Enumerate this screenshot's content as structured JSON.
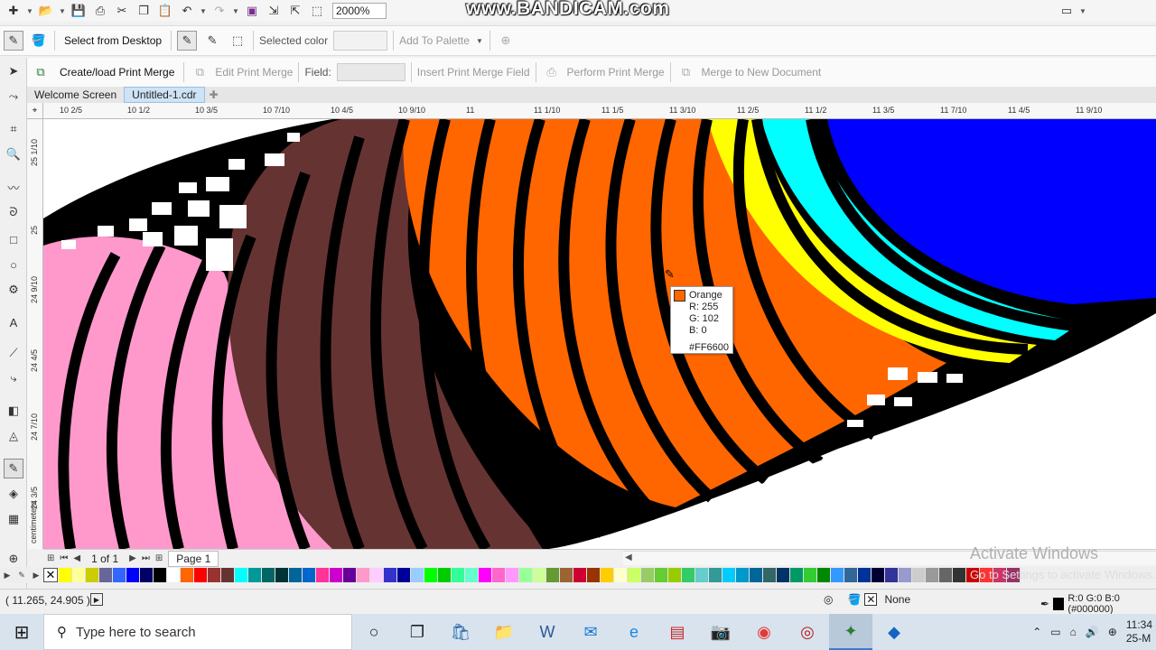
{
  "watermark": "www.BANDICAM.com",
  "toolbar": {
    "zoom_value": "2000%"
  },
  "propbar": {
    "select_from_desktop": "Select from Desktop",
    "selected_color_label": "Selected color",
    "add_to_palette": "Add To Palette"
  },
  "mergebar": {
    "create_load": "Create/load Print Merge",
    "edit": "Edit Print Merge",
    "field_label": "Field:",
    "insert_field": "Insert Print Merge Field",
    "perform": "Perform Print Merge",
    "merge_new_doc": "Merge to New Document"
  },
  "tabs": [
    {
      "label": "Welcome Screen"
    },
    {
      "label": "Untitled-1.cdr"
    }
  ],
  "hruler_ticks": [
    "10 2/5",
    "10 1/2",
    "10 3/5",
    "10 7/10",
    "10 4/5",
    "10 9/10",
    "11",
    "11 1/10",
    "11 1/5",
    "11 3/10",
    "11 2/5",
    "11 1/2",
    "11 3/5",
    "11 7/10",
    "11 4/5",
    "11 9/10"
  ],
  "vruler_ticks": [
    "25 1/10",
    "25",
    "24 9/10",
    "24 4/5",
    "24 7/10",
    "24 3/5"
  ],
  "vruler_unit": "centimeters",
  "tooltip": {
    "name": "Orange",
    "r": "R: 255",
    "g": "G: 102",
    "b": "B: 0",
    "hex": "#FF6600"
  },
  "colors": {
    "orange": "#ff6600",
    "brown": "#663333",
    "pink": "#ff99cc",
    "yellow": "#ffff00",
    "cyan": "#00ffff",
    "blue": "#0000ff"
  },
  "pagebar": {
    "page_count": "1 of 1",
    "page_tab": "Page 1"
  },
  "palette": [
    "#ffff00",
    "#ffff99",
    "#cccc00",
    "#666699",
    "#3366ff",
    "#0000ff",
    "#000066",
    "#000000",
    "#ffffff",
    "#ff6600",
    "#ff0000",
    "#993333",
    "#663333",
    "#00ffff",
    "#009999",
    "#006666",
    "#003333",
    "#006699",
    "#0066cc",
    "#ff3399",
    "#cc00cc",
    "#660099",
    "#ff99cc",
    "#ffccff",
    "#3333cc",
    "#000099",
    "#99ccff",
    "#00ff00",
    "#00cc00",
    "#33ff99",
    "#66ffcc",
    "#ff00ff",
    "#ff66cc",
    "#ff99ff",
    "#99ff99",
    "#ccff99",
    "#669933",
    "#996633",
    "#cc0033",
    "#993300",
    "#ffcc00",
    "#ffffcc",
    "#ccff66",
    "#99cc66",
    "#66cc33",
    "#99cc00",
    "#33cc66",
    "#66cccc",
    "#339999",
    "#00ccff",
    "#0099cc",
    "#006699",
    "#336666",
    "#003366",
    "#009966",
    "#33cc33",
    "#008800",
    "#3399ff",
    "#336699",
    "#003399",
    "#000033",
    "#333399",
    "#9999cc",
    "#cccccc",
    "#999999",
    "#666666",
    "#333333",
    "#cc0000",
    "#ff3333",
    "#cc3366",
    "#993366"
  ],
  "activate": {
    "line1": "Activate Windows",
    "line2": "Go to Settings to activate Windows."
  },
  "status": {
    "coords": "( 11.265, 24.905 )",
    "fill": "None",
    "outline": "R:0 G:0 B:0 (#000000)"
  },
  "taskbar": {
    "search_placeholder": "Type here to search",
    "time": "11:34",
    "date": "25-M"
  }
}
